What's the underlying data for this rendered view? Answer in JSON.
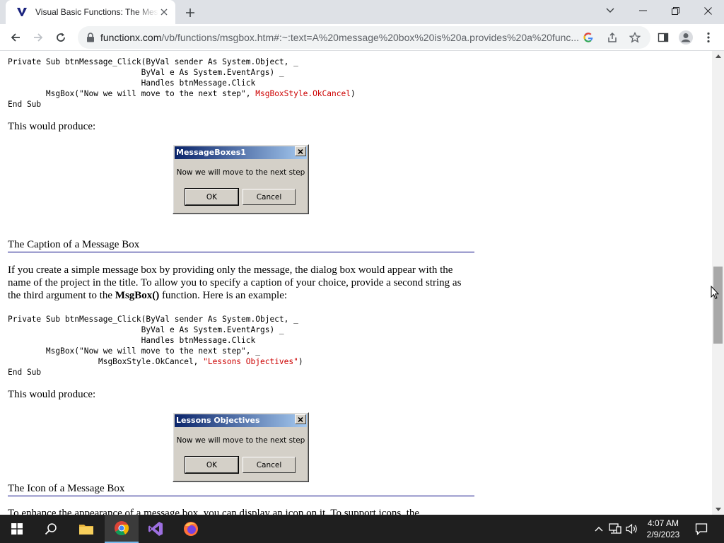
{
  "browser": {
    "tab_title": "Visual Basic Functions: The Message Box",
    "url_host": "functionx.com",
    "url_path": "/vb/functions/msgbox.htm#:~:text=A%20message%20box%20is%20a.provides%20a%20func..."
  },
  "page": {
    "code1": {
      "line1": "Private Sub btnMessage_Click(ByVal sender As System.Object, _",
      "line2": "                            ByVal e As System.EventArgs) _",
      "line3": "                            Handles btnMessage.Click",
      "line4_prefix": "        MsgBox(\"Now we will move to the next step\", ",
      "line4_highlight": "MsgBoxStyle.OkCancel",
      "line4_suffix": ")",
      "line5": "End Sub"
    },
    "produce1": "This would produce:",
    "msgbox1": {
      "title": "MessageBoxes1",
      "message": "Now we will move to the next step",
      "ok": "OK",
      "cancel": "Cancel"
    },
    "heading_caption": "The Caption of a Message Box",
    "para_caption_part1": "If you create a simple message box by providing only the message, the dialog box would appear with the name of the project in the title. To allow you to specify a caption of your choice, provide a second string as the third argument to the ",
    "para_caption_bold": "MsgBox()",
    "para_caption_part2": " function. Here is an example:",
    "code2": {
      "line1": "Private Sub btnMessage_Click(ByVal sender As System.Object, _",
      "line2": "                            ByVal e As System.EventArgs) _",
      "line3": "                            Handles btnMessage.Click",
      "line4": "        MsgBox(\"Now we will move to the next step\", _",
      "line5_prefix": "                   MsgBoxStyle.OkCancel, ",
      "line5_highlight": "\"Lessons Objectives\"",
      "line5_suffix": ")",
      "line6": "End Sub"
    },
    "produce2": "This would produce:",
    "msgbox2": {
      "title": "Lessons Objectives",
      "message": "Now we will move to the next step",
      "ok": "OK",
      "cancel": "Cancel"
    },
    "heading_icon": "The Icon of a Message Box",
    "para_icon_partial": "To enhance the appearance of a message box, you can display an icon on it. To support icons, the"
  },
  "taskbar": {
    "time": "4:07 AM",
    "date": "2/9/2023",
    "apps": [
      "file-explorer-icon",
      "chrome-icon",
      "visual-studio-icon",
      "firefox-icon"
    ]
  },
  "colors": {
    "code_highlight": "#cc0000",
    "heading_rule": "#000080",
    "taskbar": "#1f1f1f",
    "dialog_face": "#d4d0c8"
  }
}
